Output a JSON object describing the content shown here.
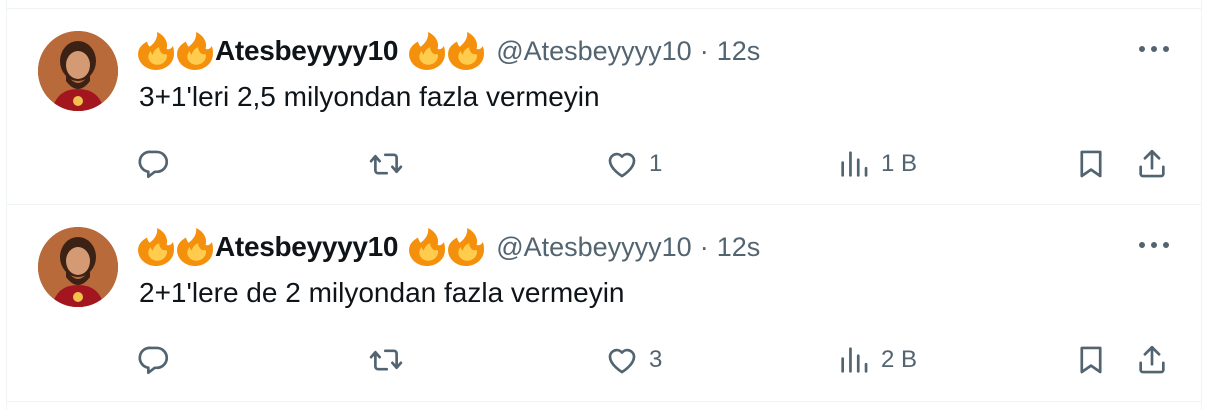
{
  "tweets": [
    {
      "display_name": "Atesbeyyyy10",
      "handle": "@Atesbeyyyy10",
      "separator": "·",
      "time": "12s",
      "text": "3+1'leri 2,5 milyondan fazla vermeyin",
      "replies": "",
      "retweets": "",
      "likes": "1",
      "views": "1 B"
    },
    {
      "display_name": "Atesbeyyyy10",
      "handle": "@Atesbeyyyy10",
      "separator": "·",
      "time": "12s",
      "text": "2+1'lere de 2 milyondan fazla vermeyin",
      "replies": "",
      "retweets": "",
      "likes": "3",
      "views": "2 B"
    }
  ],
  "icons": {
    "flame": "fire-emoji-icon",
    "more": "more-horizontal-icon",
    "reply": "reply-icon",
    "retweet": "retweet-icon",
    "like": "heart-icon",
    "views": "views-chart-icon",
    "bookmark": "bookmark-icon",
    "share": "share-icon"
  },
  "colors": {
    "text": "#0f1419",
    "secondary": "#536471",
    "border": "#eff3f4",
    "flame_outer": "#f4900c",
    "flame_inner": "#ffcc4d"
  }
}
